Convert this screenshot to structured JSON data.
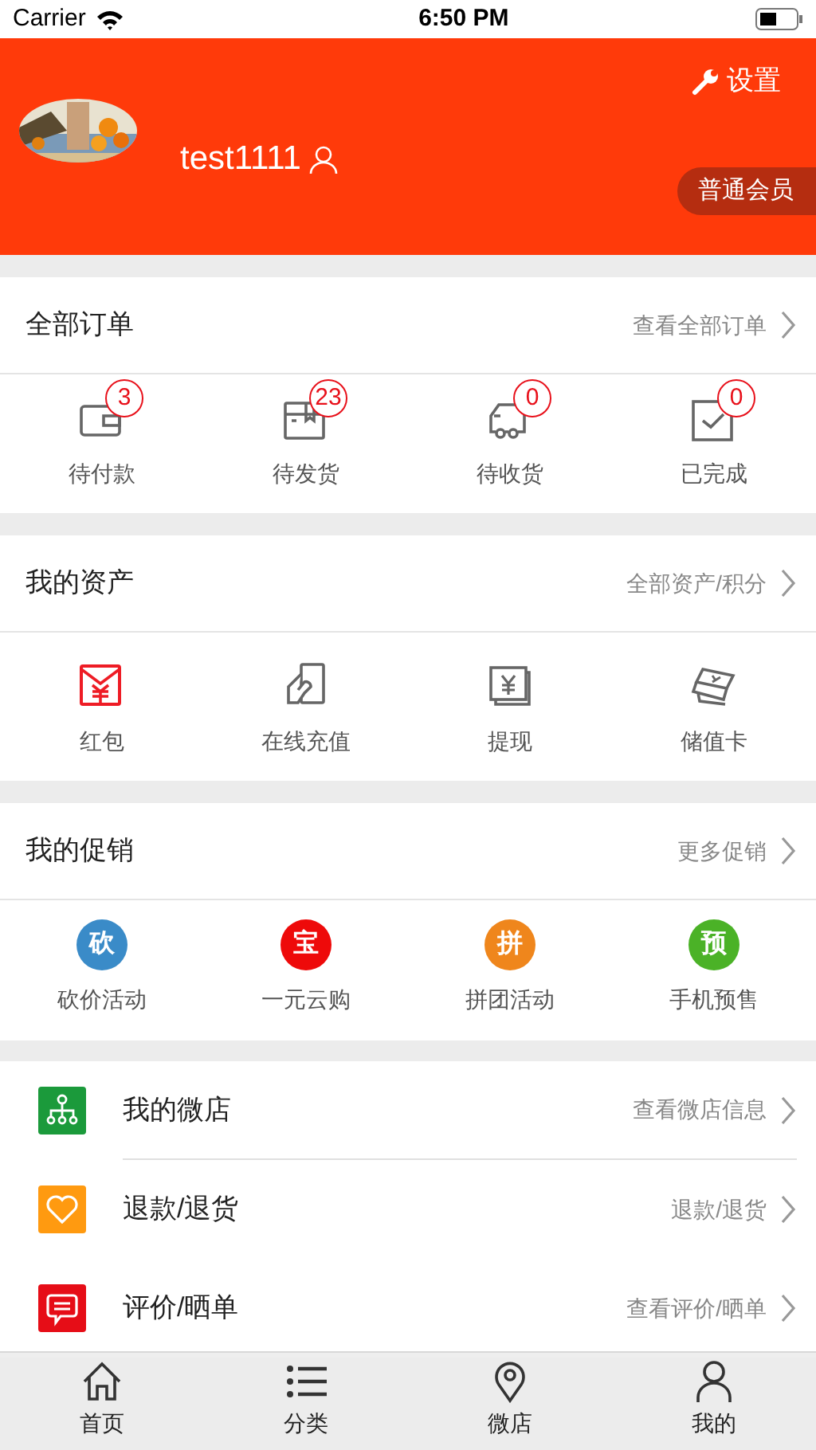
{
  "status_bar": {
    "carrier": "Carrier",
    "time": "6:50 PM"
  },
  "header": {
    "settings": "设置",
    "username": "test1111",
    "member_level": "普通会员"
  },
  "orders": {
    "title": "全部订单",
    "link": "查看全部订单",
    "items": [
      {
        "label": "待付款",
        "badge": "3",
        "kind": "wallet"
      },
      {
        "label": "待发货",
        "badge": "23",
        "kind": "box"
      },
      {
        "label": "待收货",
        "badge": "0",
        "kind": "truck"
      },
      {
        "label": "已完成",
        "badge": "0",
        "kind": "check"
      }
    ]
  },
  "assets": {
    "title": "我的资产",
    "link": "全部资产/积分",
    "items": [
      {
        "label": "红包",
        "kind": "envelope"
      },
      {
        "label": "在线充值",
        "kind": "phone"
      },
      {
        "label": "提现",
        "kind": "yen"
      },
      {
        "label": "储值卡",
        "kind": "cards"
      }
    ]
  },
  "promotions": {
    "title": "我的促销",
    "link": "更多促销",
    "items": [
      {
        "label": "砍价活动",
        "glyph": "砍",
        "color": "#3a8bc8"
      },
      {
        "label": "一元云购",
        "glyph": "宝",
        "color": "#ee0a0a"
      },
      {
        "label": "拼团活动",
        "glyph": "拼",
        "color": "#ef861c"
      },
      {
        "label": "手机预售",
        "glyph": "预",
        "color": "#4bb227"
      }
    ]
  },
  "menu": [
    {
      "title": "我的微店",
      "link": "查看微店信息",
      "kind": "tree",
      "color": "#1b9a3b"
    },
    {
      "title": "退款/退货",
      "link": "退款/退货",
      "kind": "heart",
      "color": "#ff9a10"
    },
    {
      "title": "评价/晒单",
      "link": "查看评价/晒单",
      "kind": "message",
      "color": "#e60d17"
    }
  ],
  "tab_bar": [
    {
      "label": "首页",
      "kind": "home",
      "selected": false
    },
    {
      "label": "分类",
      "kind": "list",
      "selected": false
    },
    {
      "label": "微店",
      "kind": "pin",
      "selected": false
    },
    {
      "label": "我的",
      "kind": "person",
      "selected": false
    }
  ]
}
